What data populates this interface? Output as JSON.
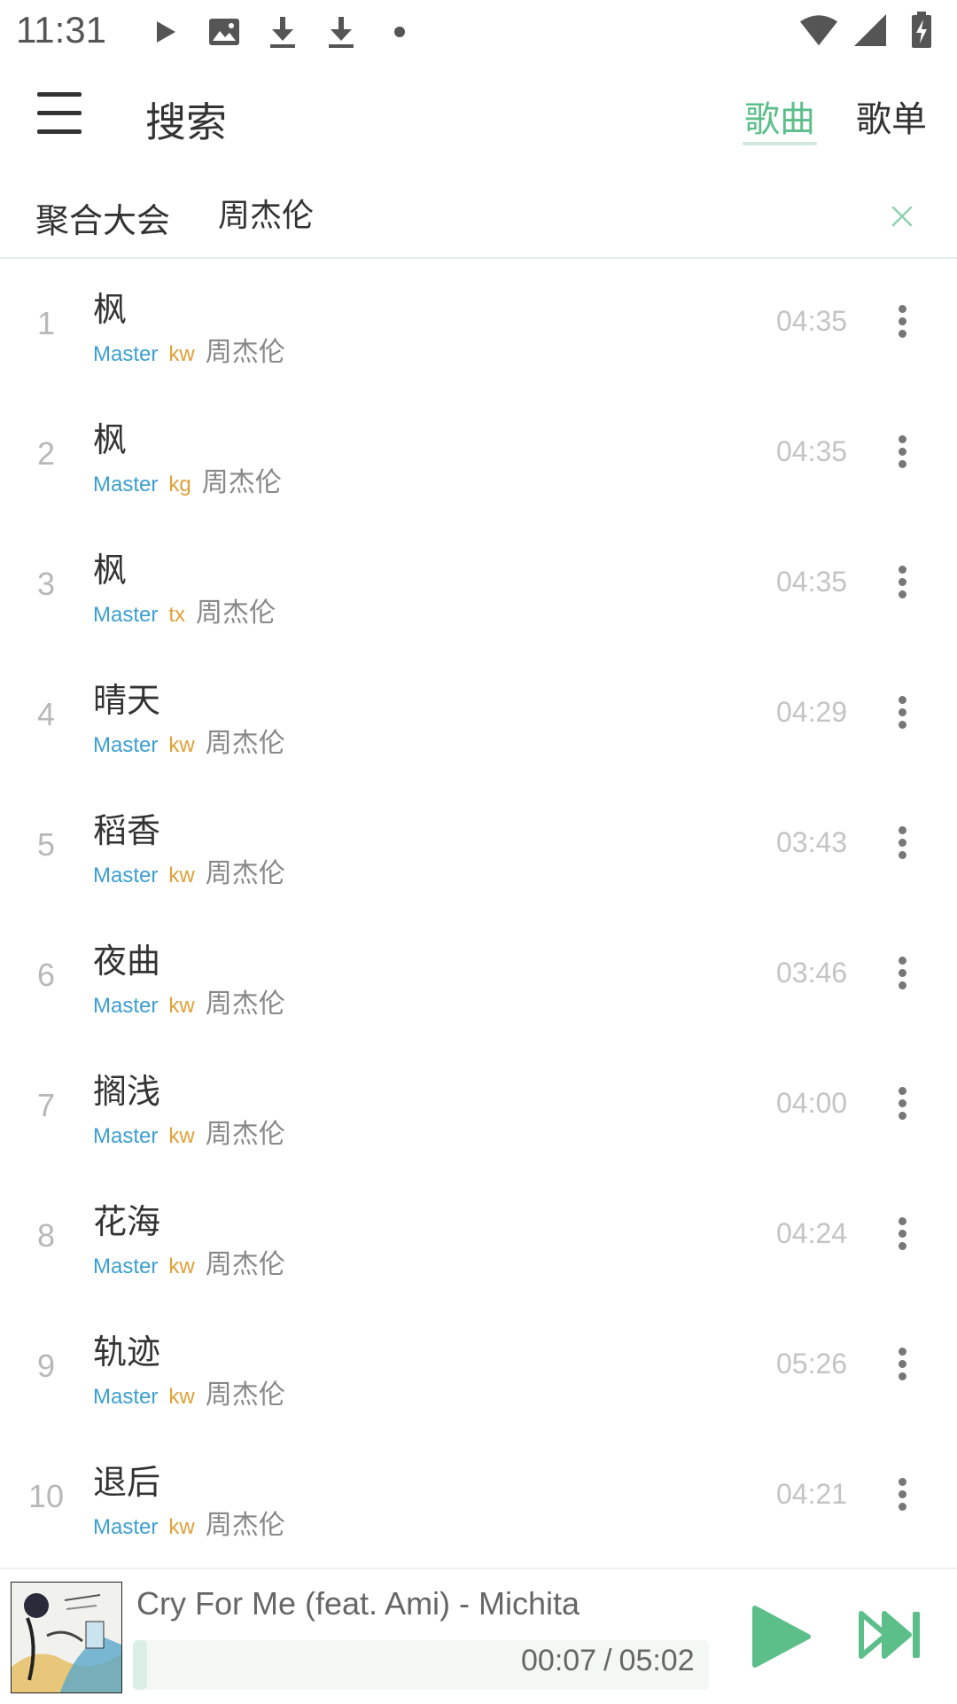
{
  "status_bar": {
    "time": "11:31",
    "icons": [
      "play-icon",
      "image-icon",
      "download-icon",
      "download-icon",
      "dot-icon",
      "wifi-icon",
      "signal-icon",
      "battery-charging-icon"
    ]
  },
  "header": {
    "title": "搜索",
    "tabs": [
      {
        "label": "歌曲",
        "active": true
      },
      {
        "label": "歌单",
        "active": false
      }
    ],
    "accent_color": "#5cbf8a"
  },
  "search": {
    "source_label": "聚合大会",
    "query": "周杰伦"
  },
  "songs": [
    {
      "index": "1",
      "name": "枫",
      "quality": "Master",
      "source": "kw",
      "singer": "周杰伦",
      "duration": "04:35"
    },
    {
      "index": "2",
      "name": "枫",
      "quality": "Master",
      "source": "kg",
      "singer": "周杰伦",
      "duration": "04:35"
    },
    {
      "index": "3",
      "name": "枫",
      "quality": "Master",
      "source": "tx",
      "singer": "周杰伦",
      "duration": "04:35"
    },
    {
      "index": "4",
      "name": "晴天",
      "quality": "Master",
      "source": "kw",
      "singer": "周杰伦",
      "duration": "04:29"
    },
    {
      "index": "5",
      "name": "稻香",
      "quality": "Master",
      "source": "kw",
      "singer": "周杰伦",
      "duration": "03:43"
    },
    {
      "index": "6",
      "name": "夜曲",
      "quality": "Master",
      "source": "kw",
      "singer": "周杰伦",
      "duration": "03:46"
    },
    {
      "index": "7",
      "name": "搁浅",
      "quality": "Master",
      "source": "kw",
      "singer": "周杰伦",
      "duration": "04:00"
    },
    {
      "index": "8",
      "name": "花海",
      "quality": "Master",
      "source": "kw",
      "singer": "周杰伦",
      "duration": "04:24"
    },
    {
      "index": "9",
      "name": "轨迹",
      "quality": "Master",
      "source": "kw",
      "singer": "周杰伦",
      "duration": "05:26"
    },
    {
      "index": "10",
      "name": "退后",
      "quality": "Master",
      "source": "kw",
      "singer": "周杰伦",
      "duration": "04:21"
    }
  ],
  "player": {
    "title": "Cry For Me (feat. Ami) - Michita",
    "current_time": "00:07",
    "separator": "/",
    "total_time": "05:02",
    "progress": 0.023
  }
}
